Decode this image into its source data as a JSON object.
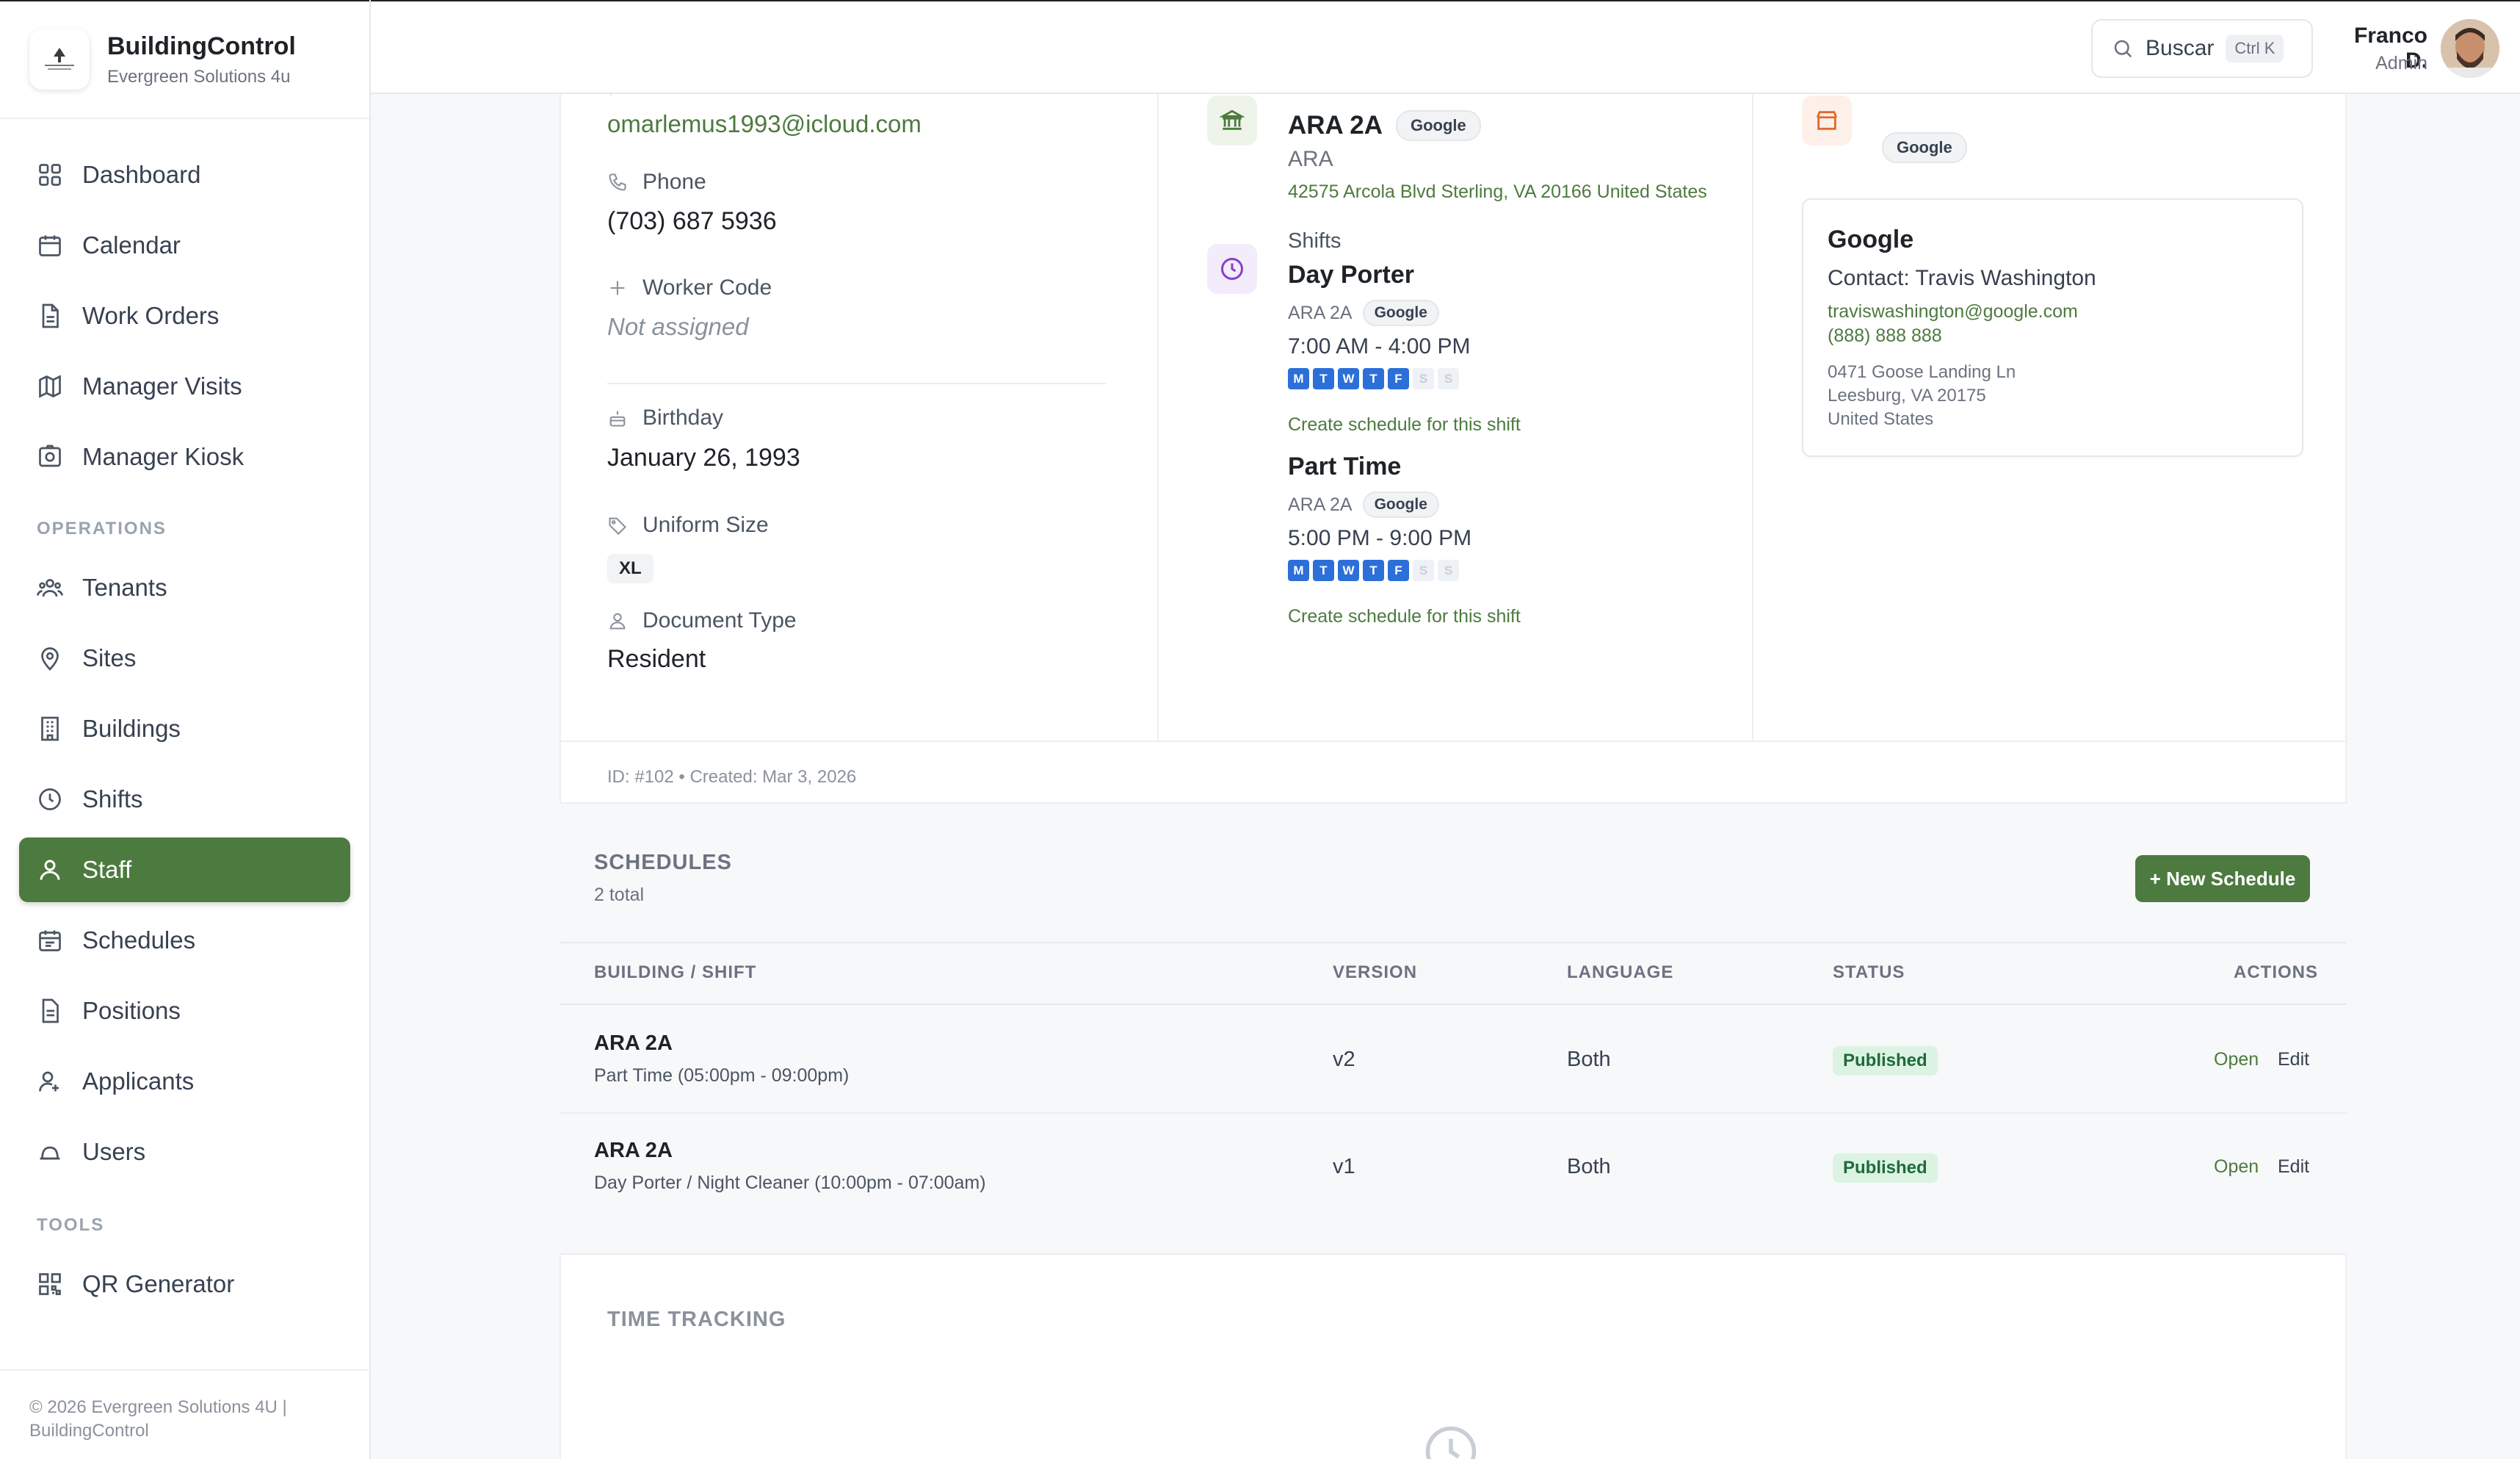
{
  "brand": {
    "name": "BuildingControl",
    "subtitle": "Evergreen Solutions 4u"
  },
  "nav": {
    "main": [
      {
        "label": "Dashboard",
        "icon": "grid-icon"
      },
      {
        "label": "Calendar",
        "icon": "calendar-icon"
      },
      {
        "label": "Work Orders",
        "icon": "document-icon"
      },
      {
        "label": "Manager Visits",
        "icon": "map-icon"
      },
      {
        "label": "Manager Kiosk",
        "icon": "camera-icon"
      }
    ],
    "operations_title": "OPERATIONS",
    "operations": [
      {
        "label": "Tenants",
        "icon": "people-icon"
      },
      {
        "label": "Sites",
        "icon": "pin-icon"
      },
      {
        "label": "Buildings",
        "icon": "building-icon"
      },
      {
        "label": "Shifts",
        "icon": "clock-icon"
      },
      {
        "label": "Staff",
        "icon": "person-icon",
        "active": true
      },
      {
        "label": "Schedules",
        "icon": "calendar-list-icon"
      },
      {
        "label": "Positions",
        "icon": "file-icon"
      },
      {
        "label": "Applicants",
        "icon": "user-plus-icon"
      },
      {
        "label": "Users",
        "icon": "bell-icon"
      }
    ],
    "tools_title": "TOOLS",
    "tools": [
      {
        "label": "QR Generator",
        "icon": "qr-icon"
      }
    ]
  },
  "footer": {
    "line1": "© 2026 Evergreen Solutions 4U |",
    "line2": "BuildingControl"
  },
  "topbar": {
    "search_label": "Buscar",
    "search_shortcut": "Ctrl K",
    "user_name": "Franco D.",
    "user_role": "Admin"
  },
  "profile": {
    "email": "omarlemus1993@icloud.com",
    "phone_label": "Phone",
    "phone": "(703) 687 5936",
    "worker_code_label": "Worker Code",
    "worker_code": "Not assigned",
    "birthday_label": "Birthday",
    "birthday": "January 26, 1993",
    "uniform_label": "Uniform Size",
    "uniform": "XL",
    "doc_label": "Document Type",
    "doc": "Resident",
    "meta": "ID: #102 • Created: Mar 3, 2026"
  },
  "assignment": {
    "building_name": "ARA 2A",
    "building_tag": "Google",
    "building_site": "ARA",
    "building_address": "42575 Arcola Blvd Sterling, VA 20166 United States",
    "shifts_label": "Shifts",
    "shifts": [
      {
        "name": "Day Porter",
        "building": "ARA 2A",
        "tag": "Google",
        "time": "7:00 AM - 4:00 PM",
        "days": [
          "M",
          "T",
          "W",
          "T",
          "F",
          "S",
          "S"
        ],
        "active": [
          true,
          true,
          true,
          true,
          true,
          false,
          false
        ],
        "action": "Create schedule for this shift"
      },
      {
        "name": "Part Time",
        "building": "ARA 2A",
        "tag": "Google",
        "time": "5:00 PM - 9:00 PM",
        "days": [
          "M",
          "T",
          "W",
          "T",
          "F",
          "S",
          "S"
        ],
        "active": [
          true,
          true,
          true,
          true,
          true,
          false,
          false
        ],
        "action": "Create schedule for this shift"
      }
    ]
  },
  "tenant": {
    "tag": "Google",
    "name": "Google",
    "contact": "Contact: Travis Washington",
    "email": "traviswashington@google.com",
    "phone": "(888) 888 888",
    "address1": "0471 Goose Landing Ln",
    "address2": "Leesburg, VA 20175",
    "address3": "United States"
  },
  "schedules": {
    "title": "SCHEDULES",
    "count": "2 total",
    "new_button": "+ New Schedule",
    "headers": {
      "building": "BUILDING / SHIFT",
      "version": "VERSION",
      "language": "LANGUAGE",
      "status": "STATUS",
      "actions": "ACTIONS"
    },
    "rows": [
      {
        "building": "ARA 2A",
        "shift": "Part Time (05:00pm - 09:00pm)",
        "version": "v2",
        "language": "Both",
        "status": "Published",
        "open": "Open",
        "edit": "Edit"
      },
      {
        "building": "ARA 2A",
        "shift": "Day Porter / Night Cleaner (10:00pm - 07:00am)",
        "version": "v1",
        "language": "Both",
        "status": "Published",
        "open": "Open",
        "edit": "Edit"
      }
    ]
  },
  "time_tracking": {
    "title": "TIME TRACKING"
  },
  "colors": {
    "accent": "#4d7a3f",
    "day_active": "#2c6fd8",
    "badge_bg": "#dcf3e3"
  }
}
